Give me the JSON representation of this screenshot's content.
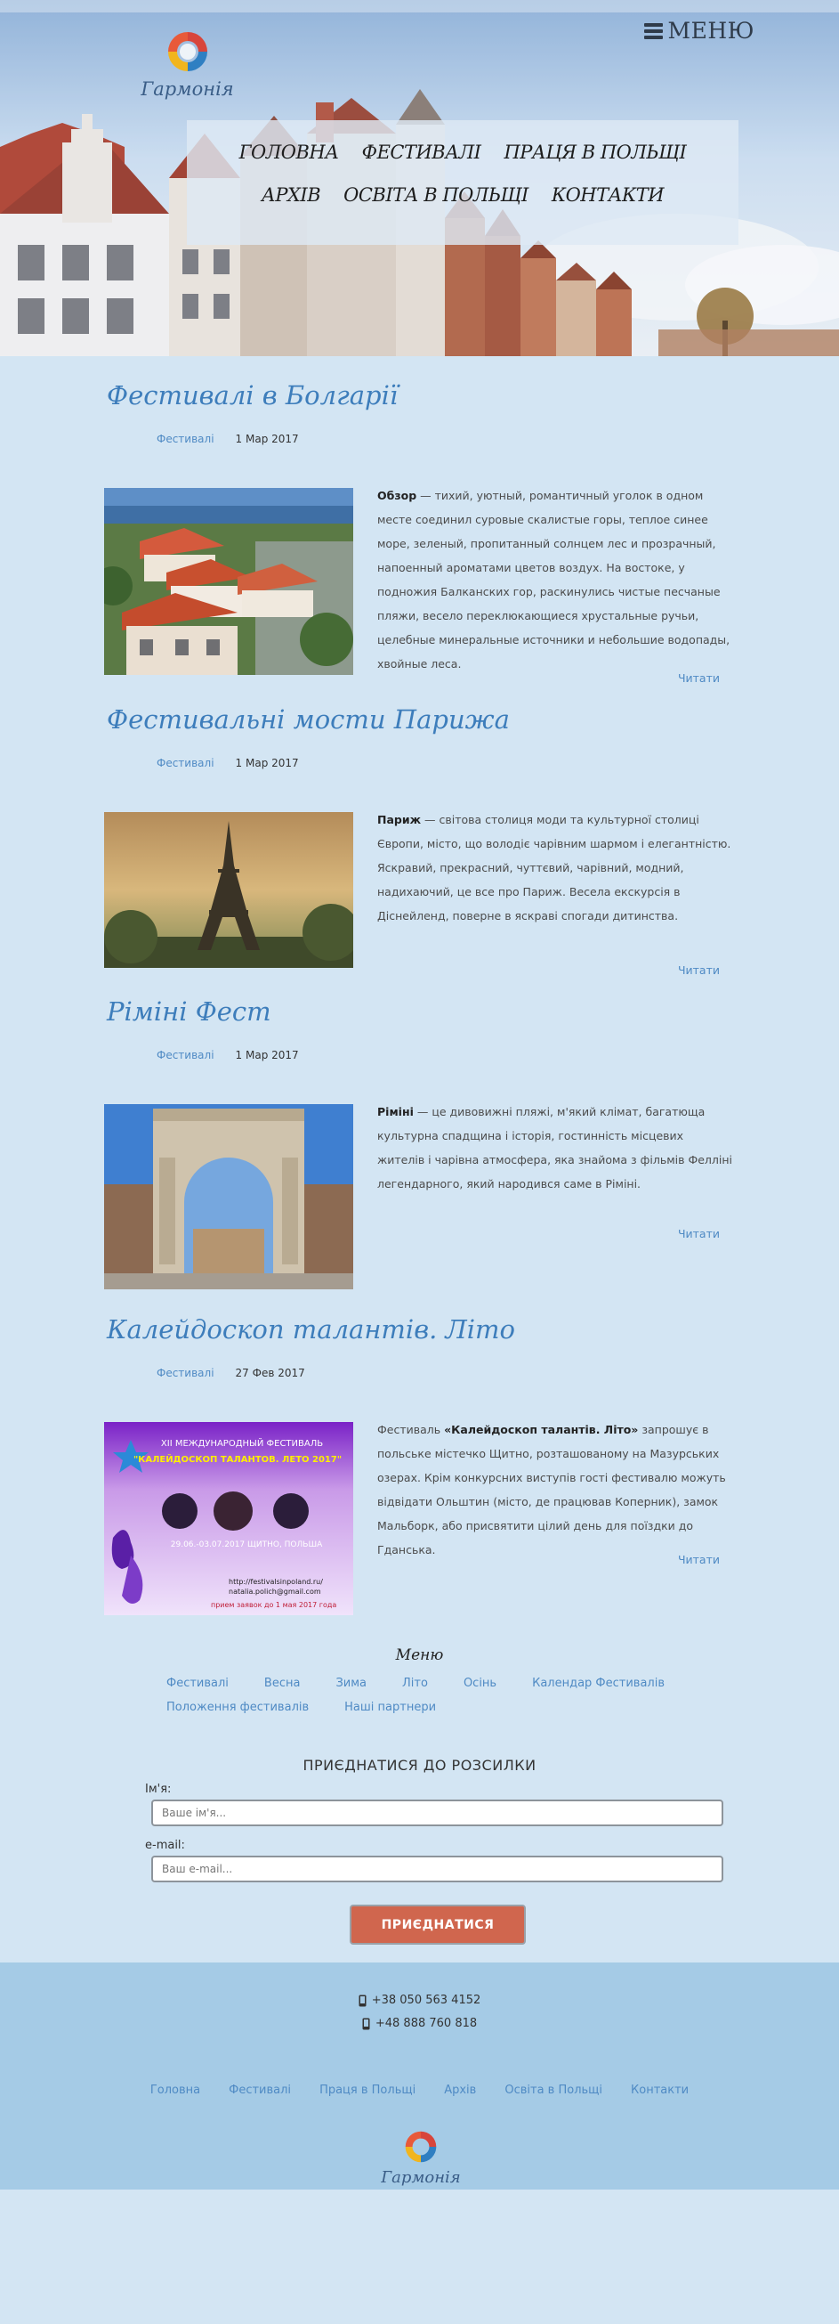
{
  "header": {
    "menu_label": "МЕНЮ",
    "logo_text": "Гармонія",
    "nav": [
      "ГОЛОВНА",
      "ФЕСТИВАЛІ",
      "ПРАЦЯ В ПОЛЬЩІ",
      "АРХІВ",
      "ОСВІТА В ПОЛЬЩІ",
      "КОНТАКТИ"
    ]
  },
  "posts": [
    {
      "title": "Фестивалі в Болгарії",
      "category": "Фестивалі",
      "date": "1 Мар 2017",
      "lead": "Обзор",
      "text": " — тихий, уютный, романтичный уголок в одном месте соединил суровые скалистые горы, теплое синее море, зеленый, пропитанный солнцем лес и прозрачный, напоенный ароматами цветов воздух. На востоке, у подножия Балканских гор, раскинулись чистые песчаные пляжи, весело переклюкающиеся хрустальные ручьи, целебные минеральные источники и небольшие водопады, хвойные леса.",
      "read_more": "Читати"
    },
    {
      "title": "Фестивальні мости Парижа",
      "category": "Фестивалі",
      "date": "1 Мар 2017",
      "lead": "Париж",
      "text": " — світова столиця моди та культурної столиці Європи,  місто, що володіє чарівним шармом і елегантністю. Яскравий, прекрасний, чуттєвий, чарівний, модний, надихаючий, це все про Париж. Весела екскурсія в Діснейленд, поверне в яскраві спогади дитинства.",
      "read_more": "Читати"
    },
    {
      "title": "Ріміні Фест",
      "category": "Фестивалі",
      "date": "1 Мар 2017",
      "lead": "Ріміні",
      "text": " — це дивовижні пляжі, м'який клімат, багатюща культурна спадщина і історія, гостинність місцевих жителів і чарівна атмосфера, яка знайома з фільмів Фелліні легендарного, який народився саме в Ріміні.",
      "read_more": "Читати"
    },
    {
      "title": "Калейдоскоп талантів. Літо",
      "category": "Фестивалі",
      "date": "27 Фев 2017",
      "lead_pre": "Фестиваль ",
      "lead": "«Калейдоскоп талантів. Літо»",
      "text": " запрошує в польське містечко Щитно, розташованому на Мазурських озерах. Крім конкурсних виступів гості фестивалю можуть відвідати Ольштин (місто, де працював Коперник), замок Мальборк, або присвятити цілий день для поїздки до Гданська.",
      "read_more": "Читати",
      "poster": {
        "line1": "XII МЕЖДУНАРОДНЫЙ ФЕСТИВАЛЬ",
        "line2": "\"КАЛЕЙДОСКОП ТАЛАНТОВ. ЛЕТО 2017\"",
        "line3": "29.06.-03.07.2017 ЩИТНО, ПОЛЬША",
        "line4": "http://festivalsinpoland.ru/",
        "line5": "natalia.polich@gmail.com",
        "line6": "прием заявок до 1 мая 2017 года"
      }
    }
  ],
  "footer_menu": {
    "title": "Меню",
    "items": [
      "Фестивалі",
      "Весна",
      "Зима",
      "Літо",
      "Осінь",
      "Календар Фестивалів",
      "Положення фестивалів",
      "Наші партнери"
    ]
  },
  "subscribe": {
    "title": "ПРИЄДНАТИСЯ ДО РОЗСИЛКИ",
    "name_label": "Ім'я:",
    "name_placeholder": "Ваше ім'я...",
    "email_label": "e-mail:",
    "email_placeholder": "Ваш e-mail...",
    "button": "ПРИЄДНАТИСЯ"
  },
  "footer": {
    "phones": [
      "+38 050 563 4152",
      "+48 888 760 818"
    ],
    "nav": [
      "Головна",
      "Фестивалі",
      "Праця в Польщі",
      "Архів",
      "Освіта в Польщі",
      "Контакти"
    ],
    "logo_text": "Гармонія"
  },
  "colors": {
    "page_bg": "#d3e5f3",
    "title_blue": "#3d7dbb",
    "link_blue": "#4f8ac4",
    "button": "#d0664e",
    "footer_bg": "#a5cbe6"
  }
}
